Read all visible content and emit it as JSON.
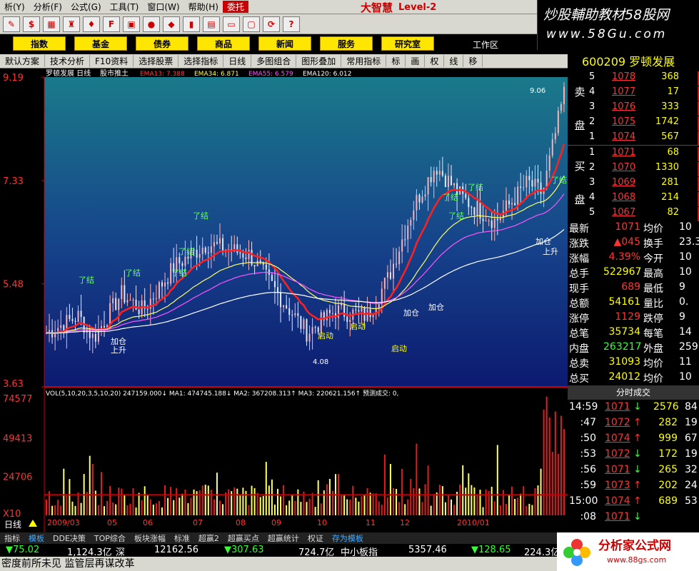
{
  "menu": [
    "析(Y)",
    "分析(F)",
    "公式(G)",
    "工具(T)",
    "窗口(W)",
    "帮助(H)",
    "委托"
  ],
  "brand": {
    "name": "大智慧",
    "level": "Level-2"
  },
  "ad": {
    "line1": "炒股輔助教材58股网",
    "line2": "www.58Gu.com"
  },
  "toolbar_icons": [
    "pencil-icon",
    "dollar-icon",
    "flag-icon",
    "binoculars-icon",
    "gift-icon",
    "f10-icon",
    "map-icon",
    "circle-icon",
    "diamond-icon",
    "vertical-icon",
    "chart-icon",
    "monitor-icon",
    "window-icon",
    "sync-icon",
    "help-icon"
  ],
  "nav": [
    "指数",
    "基金",
    "债券",
    "商品",
    "新闻",
    "服务",
    "研究室"
  ],
  "workzone": "工作区",
  "rowbar": [
    "默认方案",
    "技术分析",
    "F10资料",
    "选择股票",
    "选择指标",
    "日线",
    "多图组合",
    "图形叠加",
    "常用指标",
    "标",
    "画",
    "权",
    "线",
    "移"
  ],
  "stock": {
    "code": "600209",
    "name": "罗顿发展"
  },
  "chart_data": {
    "type": "line",
    "title": "罗顿发展 日线",
    "indicator_name": "股市推土",
    "ema_labels": [
      {
        "name": "EMA13",
        "value": "7.388",
        "color": "#ff3b3b"
      },
      {
        "name": "EMA34",
        "value": "6.871",
        "color": "#ffff55"
      },
      {
        "name": "EMA55",
        "value": "6.579",
        "color": "#ff55ff"
      },
      {
        "name": "EMA120",
        "value": "6.012",
        "color": "#ffffff"
      }
    ],
    "y_ticks": [
      "9.19",
      "7.33",
      "5.48",
      "3.63"
    ],
    "ylim": [
      3.63,
      9.19
    ],
    "price_annotations": {
      "high": "9.06",
      "low": "4.08"
    },
    "signals": [
      "了结",
      "了结",
      "了结",
      "了结",
      "了结",
      "了结",
      "了结",
      "了结",
      "了结",
      "启动",
      "启动",
      "启动",
      "加仓",
      "上升",
      "加仓",
      "加仓",
      "加仓",
      "上升"
    ],
    "vol_label": "VOL(5,10,20,3,5,10,20) 247159.000↓ MA1: 474745.188↓ MA2: 367208.313↑ MA3: 220621.156↑ 预测成交: 0,",
    "vol_ticks": [
      "74577",
      "49413",
      "24706",
      "X10"
    ],
    "x_ticks": [
      "2009/03",
      "05",
      "06",
      "07",
      "08",
      "09",
      "10",
      "11",
      "12",
      "2010/01"
    ],
    "note": "Price series approximated from the figure."
  },
  "order_book": {
    "sell_label": [
      "卖",
      "盘"
    ],
    "buy_label": [
      "买",
      "盘"
    ],
    "sell": [
      {
        "lv": "5",
        "price": "1078",
        "qty": "368"
      },
      {
        "lv": "4",
        "price": "1077",
        "qty": "17"
      },
      {
        "lv": "3",
        "price": "1076",
        "qty": "333"
      },
      {
        "lv": "2",
        "price": "1075",
        "qty": "1742"
      },
      {
        "lv": "1",
        "price": "1074",
        "qty": "567"
      }
    ],
    "buy": [
      {
        "lv": "1",
        "price": "1071",
        "qty": "68"
      },
      {
        "lv": "2",
        "price": "1070",
        "qty": "1330"
      },
      {
        "lv": "3",
        "price": "1069",
        "qty": "281"
      },
      {
        "lv": "4",
        "price": "1068",
        "qty": "214"
      },
      {
        "lv": "5",
        "price": "1067",
        "qty": "82"
      }
    ]
  },
  "stats": [
    {
      "k": "最新",
      "v": "1071",
      "vc": "#f33",
      "k2": "均价",
      "v2": "10"
    },
    {
      "k": "涨跌",
      "v": "▲045",
      "vc": "#f33",
      "k2": "换手",
      "v2": "23.3"
    },
    {
      "k": "涨幅",
      "v": "4.39%",
      "vc": "#f33",
      "k2": "今开",
      "v2": "10"
    },
    {
      "k": "总手",
      "v": "522967",
      "vc": "#ff0",
      "k2": "最高",
      "v2": "10"
    },
    {
      "k": "现手",
      "v": "689",
      "vc": "#f33",
      "k2": "最低",
      "v2": "9"
    },
    {
      "k": "总额",
      "v": "54161",
      "vc": "#ff0",
      "k2": "量比",
      "v2": "0."
    },
    {
      "k": "涨停",
      "v": "1129",
      "vc": "#f33",
      "k2": "跌停",
      "v2": "9"
    },
    {
      "k": "总笔",
      "v": "35734",
      "vc": "#ff0",
      "k2": "每笔",
      "v2": "14"
    },
    {
      "k": "内盘",
      "v": "263217",
      "vc": "#3f3",
      "k2": "外盘",
      "v2": "2597"
    },
    {
      "k": "总卖",
      "v": "31093",
      "vc": "#ff0",
      "k2": "均价",
      "v2": "11"
    },
    {
      "k": "总买",
      "v": "24012",
      "vc": "#ff0",
      "k2": "均价",
      "v2": "10"
    }
  ],
  "trades_title": "分时成交",
  "trades": [
    {
      "t": "14:59",
      "p": "1071",
      "a": "↓",
      "ac": "#3f3",
      "v": "2576",
      "n": "84"
    },
    {
      "t": ":47",
      "p": "1072",
      "a": "↑",
      "ac": "#f33",
      "v": "282",
      "n": "19"
    },
    {
      "t": ":50",
      "p": "1074",
      "a": "↑",
      "ac": "#f33",
      "v": "999",
      "n": "67"
    },
    {
      "t": ":53",
      "p": "1072",
      "a": "↓",
      "ac": "#3f3",
      "v": "172",
      "n": "19"
    },
    {
      "t": ":56",
      "p": "1071",
      "a": "↓",
      "ac": "#3f3",
      "v": "265",
      "n": "32"
    },
    {
      "t": ":59",
      "p": "1073",
      "a": "↑",
      "ac": "#f33",
      "v": "202",
      "n": "24"
    },
    {
      "t": "15:00",
      "p": "1074",
      "a": "↑",
      "ac": "#f33",
      "v": "689",
      "n": "53"
    },
    {
      "t": ":08",
      "p": "1071",
      "a": "↓",
      "ac": "#3f3",
      "v": "",
      "n": ""
    }
  ],
  "tabs": [
    "指标",
    "模板",
    "DDE决策",
    "TOP综合",
    "板块涨幅",
    "标准",
    "超赢2",
    "超赢买点",
    "超赢统计",
    "权证",
    "存为模板"
  ],
  "index": {
    "v1": "▼75.02",
    "v2": "1,124.3亿",
    "v3": "深",
    "v4": "12162.56",
    "v5": "▼307.63",
    "v6": "724.7亿",
    "v7": "中小板指",
    "v8": "5357.46",
    "v9": "▼128.65",
    "v10": "224.3亿"
  },
  "news": "密度前所未见 监管层再谋改革",
  "logo": {
    "line1": "分析家公式网",
    "line2": "www.88gs.com"
  },
  "cursor_label": "日线"
}
